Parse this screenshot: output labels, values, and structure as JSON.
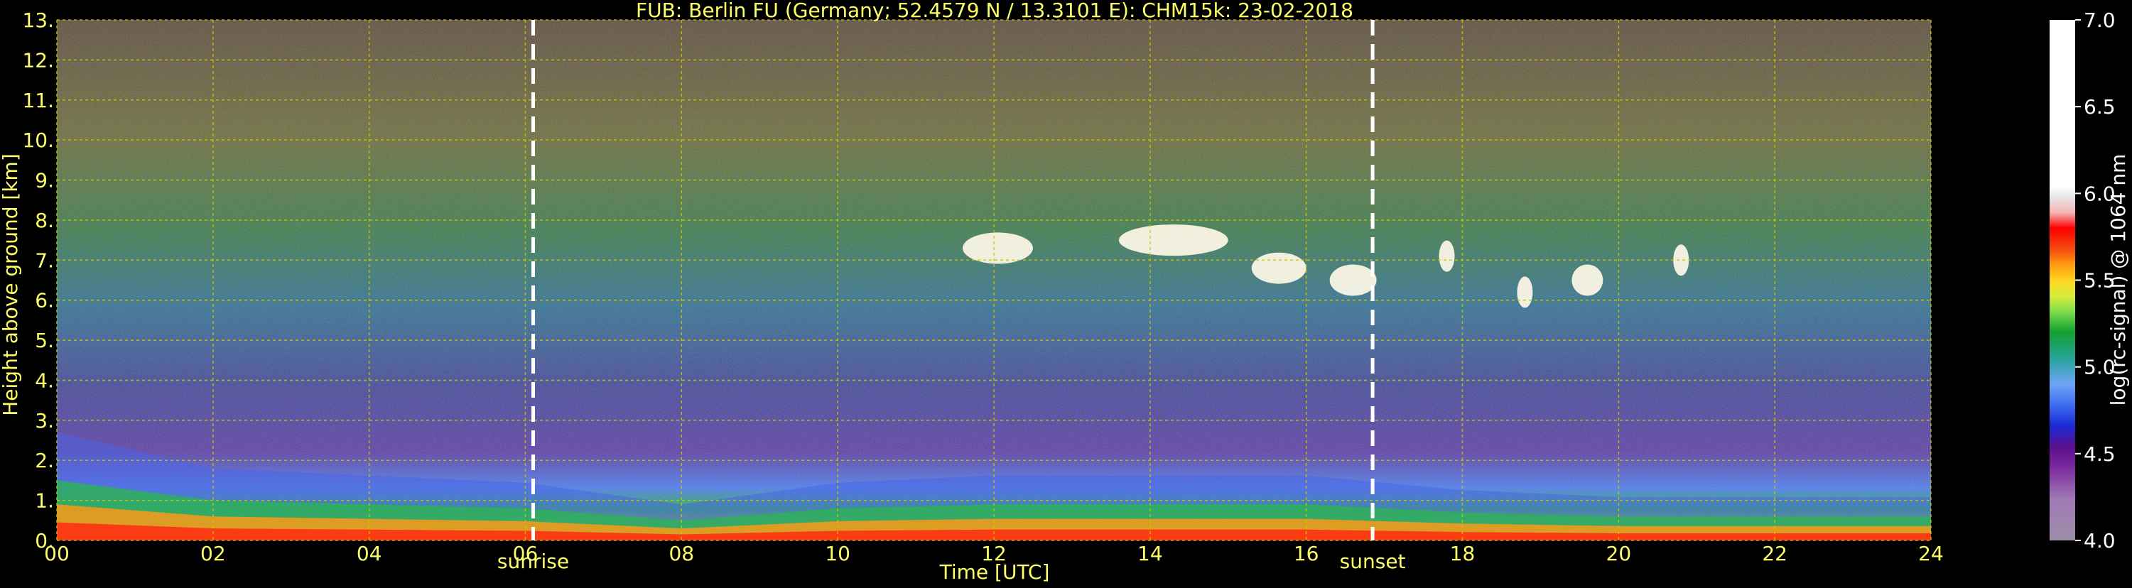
{
  "chart_data": {
    "type": "heatmap",
    "title": "FUB: Berlin FU (Germany; 52.4579 N / 13.3101 E):    CHM15k: 23-02-2018",
    "xlabel": "Time [UTC]",
    "ylabel": "Height above ground [km]",
    "xlim": [
      0,
      24
    ],
    "ylim": [
      0,
      13
    ],
    "x_ticks": [
      0,
      2,
      4,
      6,
      8,
      10,
      12,
      14,
      16,
      18,
      20,
      22,
      24
    ],
    "x_tick_labels": [
      "00",
      "02",
      "04",
      "06",
      "08",
      "10",
      "12",
      "14",
      "16",
      "18",
      "20",
      "22",
      "24"
    ],
    "y_ticks": [
      0,
      1,
      2,
      3,
      4,
      5,
      6,
      7,
      8,
      9,
      10,
      11,
      12,
      13
    ],
    "y_tick_labels": [
      "0.",
      "1.",
      "2.",
      "3.",
      "4.",
      "5.",
      "6.",
      "7.",
      "8.",
      "9.",
      "10.",
      "11.",
      "12.",
      "13."
    ],
    "grid": true,
    "annotations": [
      {
        "label": "sunrise",
        "x": 6.1
      },
      {
        "label": "sunset",
        "x": 16.85
      }
    ],
    "colorbar": {
      "label": "log(rc-signal) @ 1064 nm",
      "range": [
        4.0,
        7.0
      ],
      "ticks": [
        4.0,
        4.5,
        5.0,
        5.5,
        6.0,
        6.5,
        7.0
      ],
      "tick_labels": [
        "4.0",
        "4.5",
        "5.0",
        "5.5",
        "6.0",
        "6.5",
        "7.0"
      ]
    },
    "boundary_layer": [
      {
        "time": 0,
        "aerosol_top_km": 1.5
      },
      {
        "time": 2,
        "aerosol_top_km": 1.0
      },
      {
        "time": 4,
        "aerosol_top_km": 0.9
      },
      {
        "time": 6,
        "aerosol_top_km": 0.8
      },
      {
        "time": 8,
        "aerosol_top_km": 0.5
      },
      {
        "time": 10,
        "aerosol_top_km": 0.8
      },
      {
        "time": 12,
        "aerosol_top_km": 0.9
      },
      {
        "time": 14,
        "aerosol_top_km": 0.9
      },
      {
        "time": 16,
        "aerosol_top_km": 0.9
      },
      {
        "time": 18,
        "aerosol_top_km": 0.7
      },
      {
        "time": 20,
        "aerosol_top_km": 0.6
      },
      {
        "time": 22,
        "aerosol_top_km": 0.6
      },
      {
        "time": 24,
        "aerosol_top_km": 0.6
      }
    ],
    "cirrus_clouds": [
      {
        "time_start": 11.6,
        "time_end": 12.5,
        "height_km": 7.3
      },
      {
        "time_start": 13.6,
        "time_end": 15.0,
        "height_km": 7.5
      },
      {
        "time_start": 15.3,
        "time_end": 16.0,
        "height_km": 6.8
      },
      {
        "time_start": 16.3,
        "time_end": 16.9,
        "height_km": 6.5
      },
      {
        "time_start": 17.7,
        "time_end": 17.9,
        "height_km": 7.1
      },
      {
        "time_start": 18.7,
        "time_end": 18.9,
        "height_km": 6.2
      },
      {
        "time_start": 19.4,
        "time_end": 19.8,
        "height_km": 6.5
      },
      {
        "time_start": 20.7,
        "time_end": 20.9,
        "height_km": 7.0
      }
    ]
  },
  "colors": {
    "axis_text": "#ffff66",
    "colorbar_text": "#ffffff",
    "grid": "#c8c800",
    "background": "#000000"
  }
}
